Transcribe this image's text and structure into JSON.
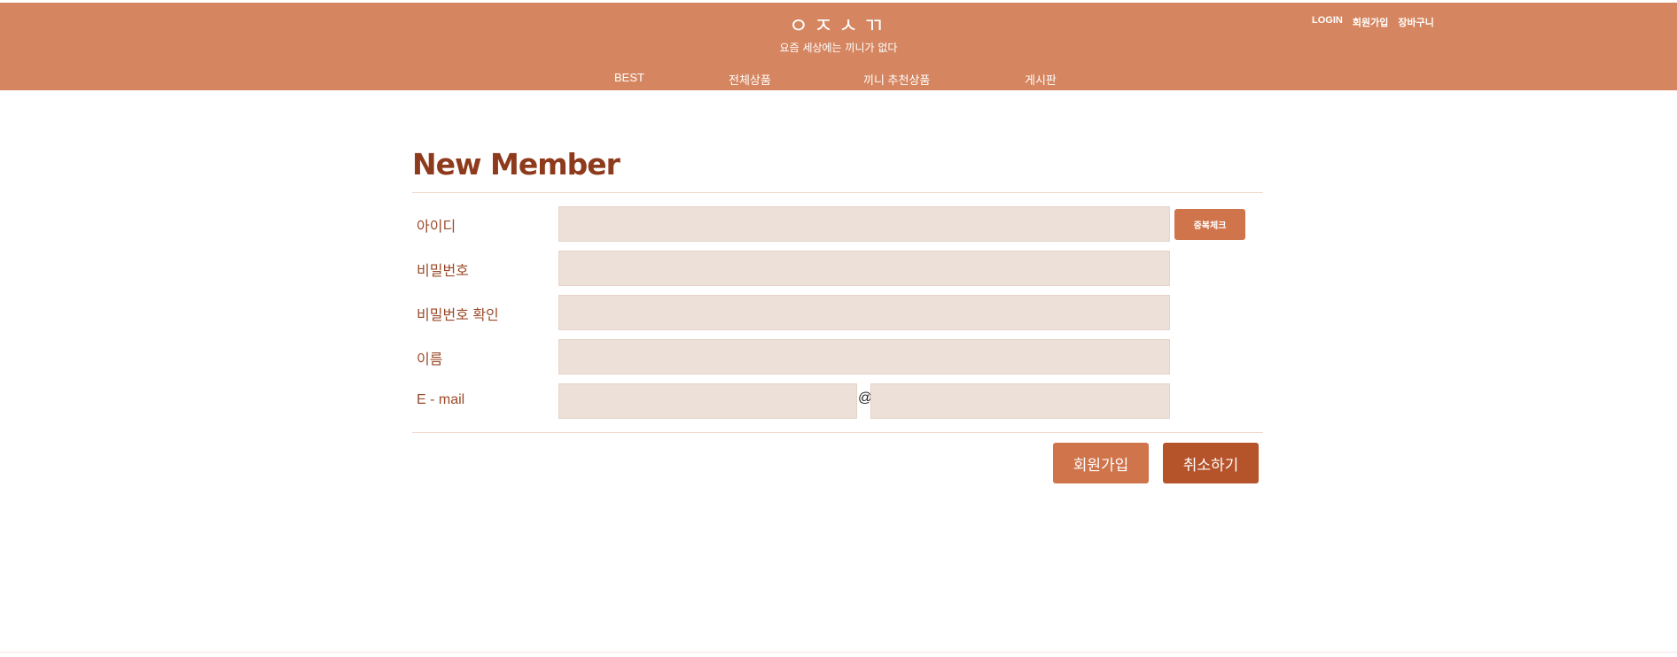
{
  "header": {
    "logo_mark": "ㅇㅈㅅㄲ",
    "logo_tagline": "요즘 세상에는 끼니가 없다",
    "util_nav": [
      "LOGIN",
      "회원가입",
      "장바구니"
    ],
    "main_nav": [
      "BEST",
      "전체상품",
      "끼니 추천상품",
      "게시판"
    ]
  },
  "form": {
    "title": "New Member",
    "labels": {
      "id": "아이디",
      "password": "비밀번호",
      "password_confirm": "비밀번호 확인",
      "name": "이름",
      "email": "E - mail"
    },
    "values": {
      "id": "",
      "password": "",
      "password_confirm": "",
      "name": "",
      "email_user": "",
      "email_domain": ""
    },
    "email_at": "@",
    "dup_check_label": "중복체크",
    "join_label": "회원가입",
    "cancel_label": "취소하기"
  },
  "colors": {
    "header_bg": "#d58660",
    "title": "#8e3a1c",
    "input_bg": "#ede0d9",
    "primary_button": "#d0744b",
    "secondary_button": "#b5532a"
  }
}
